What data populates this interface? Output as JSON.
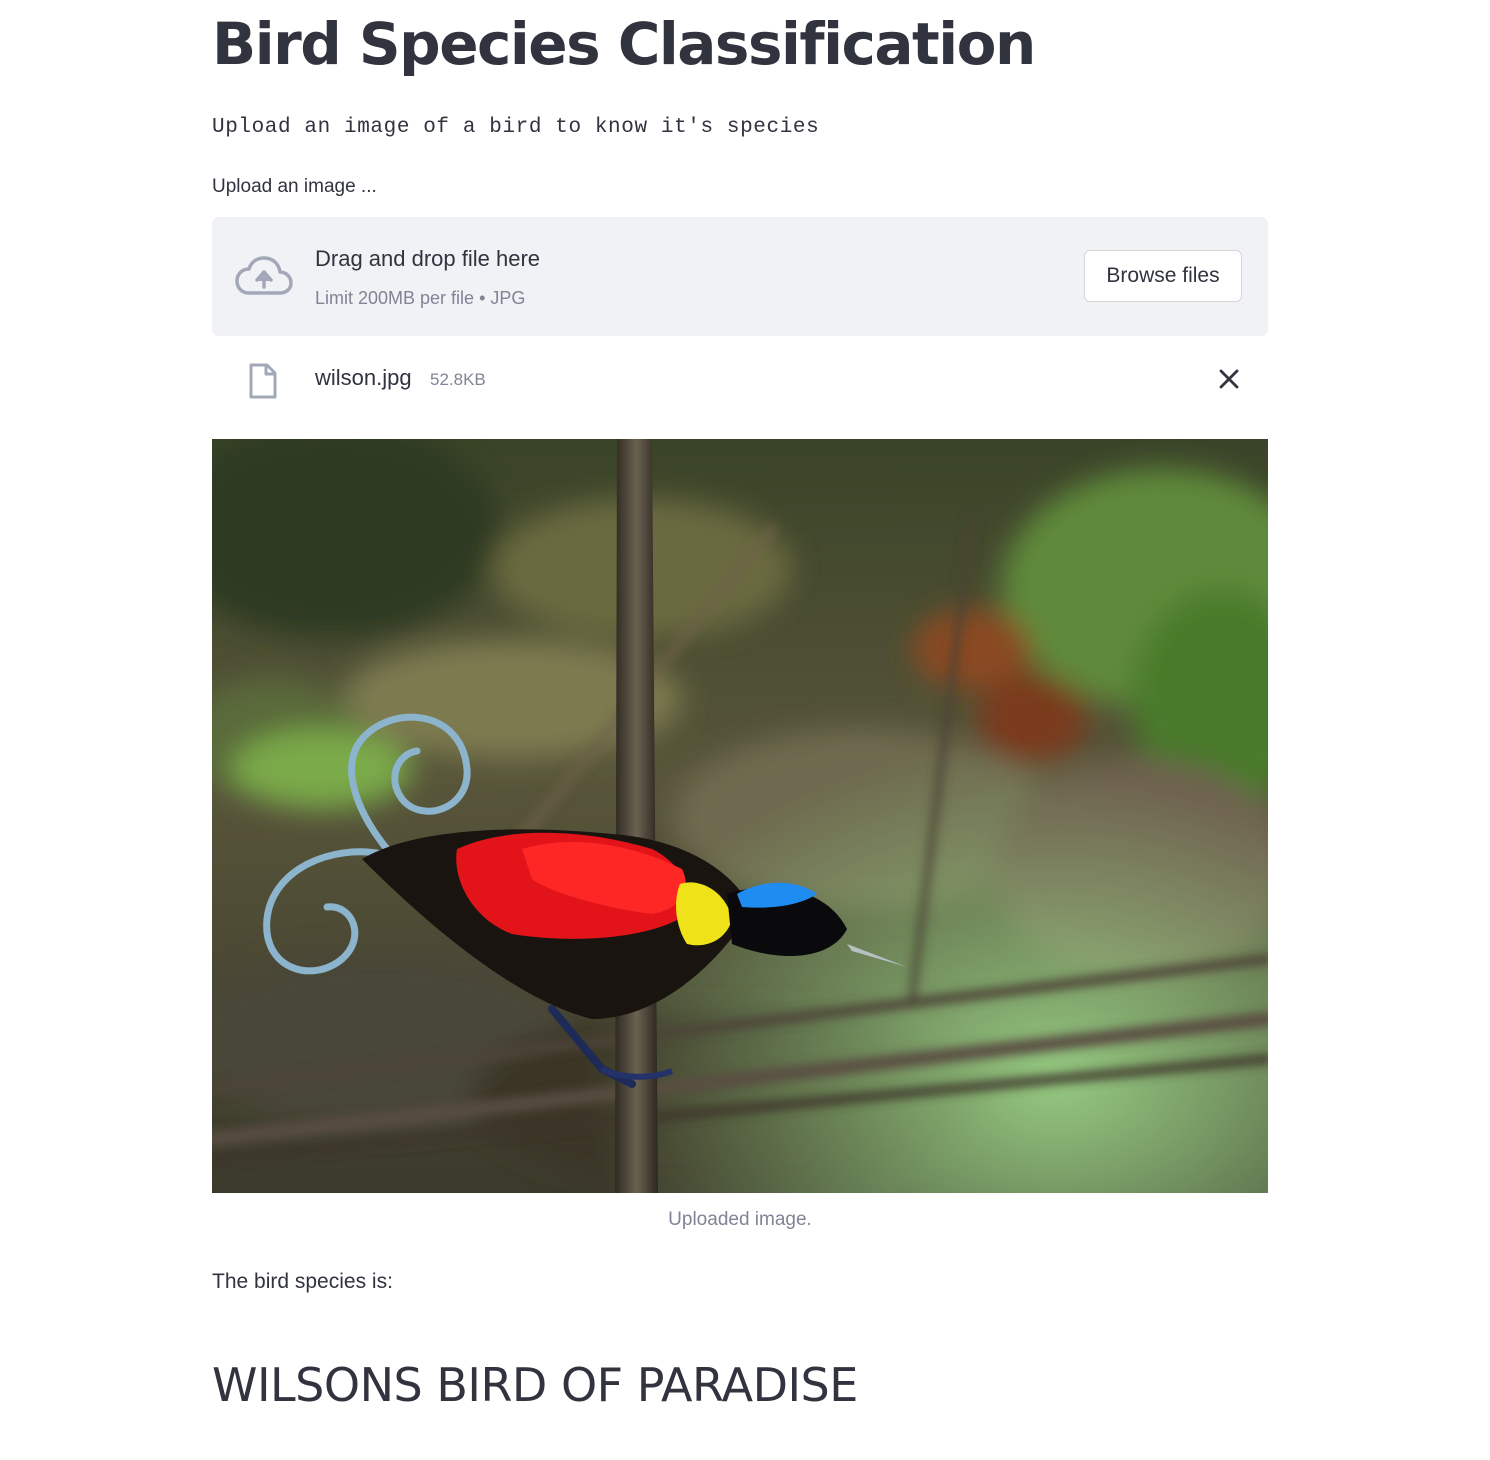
{
  "header": {
    "title": "Bird Species Classification",
    "subtitle": "Upload an image of a bird to know it's species"
  },
  "uploader": {
    "label": "Upload an image ...",
    "dropzone_text": "Drag and drop file here",
    "limit_text": "Limit 200MB per file • JPG",
    "browse_label": "Browse files",
    "cloud_icon": "cloud-upload-icon"
  },
  "uploaded_file": {
    "name": "wilson.jpg",
    "size": "52.8KB",
    "file_icon": "file-icon",
    "remove_icon": "close-icon"
  },
  "image": {
    "caption": "Uploaded image."
  },
  "result": {
    "label": "The bird species is:",
    "species": "WILSONS BIRD OF PARADISE"
  },
  "colors": {
    "text": "#31333f",
    "muted": "#808495",
    "dropzone_bg": "#f0f2f6",
    "icon": "#a3a8b8"
  }
}
